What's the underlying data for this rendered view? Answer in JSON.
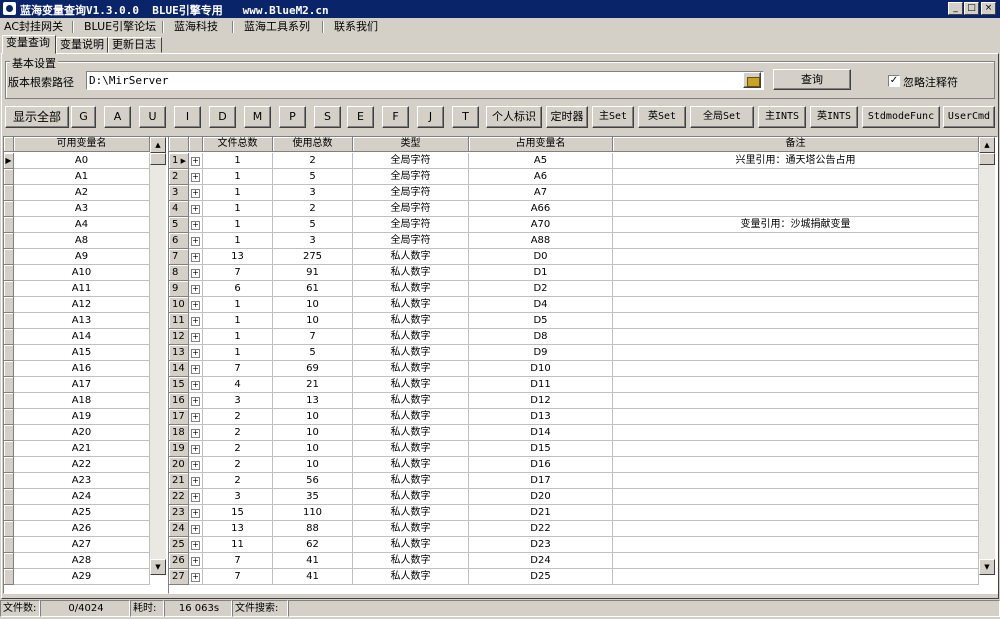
{
  "window": {
    "title": "蓝海变量查询V1.3.0.0  BLUE引擎专用   www.BlueM2.cn",
    "min_label": "_",
    "max_label": "□",
    "close_label": "×"
  },
  "menu": [
    "AC封挂网关",
    "BLUE引擎论坛",
    "蓝海科技",
    "蓝海工具系列",
    "联系我们"
  ],
  "tabs": [
    "变量查询",
    "变量说明",
    "更新日志"
  ],
  "settings": {
    "group_title": "基本设置",
    "path_label": "版本根索路径",
    "path_value": "D:\\MirServer",
    "query_button": "查询",
    "ignore_checked": true,
    "ignore_label": "忽略注释符"
  },
  "filter_buttons": [
    "显示全部",
    "G",
    "A",
    "U",
    "I",
    "D",
    "M",
    "P",
    "S",
    "E",
    "F",
    "J",
    "T",
    "个人标识",
    "定时器",
    "主Set",
    "英Set",
    "全局Set",
    "主INTS",
    "英INTS",
    "StdmodeFunc",
    "UserCmd"
  ],
  "left_grid": {
    "header": "可用变量名",
    "rows": [
      "A0",
      "A1",
      "A2",
      "A3",
      "A4",
      "A8",
      "A9",
      "A10",
      "A11",
      "A12",
      "A13",
      "A14",
      "A15",
      "A16",
      "A17",
      "A18",
      "A19",
      "A20",
      "A21",
      "A22",
      "A23",
      "A24",
      "A25",
      "A26",
      "A27",
      "A28",
      "A29"
    ]
  },
  "right_grid": {
    "headers": [
      "文件总数",
      "使用总数",
      "类型",
      "占用变量名",
      "备注"
    ],
    "rows": [
      {
        "n": "1",
        "files": "1",
        "uses": "2",
        "type": "全局字符",
        "var": "A5",
        "note": "兴里引用：通天塔公告占用"
      },
      {
        "n": "2",
        "files": "1",
        "uses": "5",
        "type": "全局字符",
        "var": "A6",
        "note": ""
      },
      {
        "n": "3",
        "files": "1",
        "uses": "3",
        "type": "全局字符",
        "var": "A7",
        "note": ""
      },
      {
        "n": "4",
        "files": "1",
        "uses": "2",
        "type": "全局字符",
        "var": "A66",
        "note": ""
      },
      {
        "n": "5",
        "files": "1",
        "uses": "5",
        "type": "全局字符",
        "var": "A70",
        "note": "变量引用：沙城捐献变量"
      },
      {
        "n": "6",
        "files": "1",
        "uses": "3",
        "type": "全局字符",
        "var": "A88",
        "note": ""
      },
      {
        "n": "7",
        "files": "13",
        "uses": "275",
        "type": "私人数字",
        "var": "D0",
        "note": ""
      },
      {
        "n": "8",
        "files": "7",
        "uses": "91",
        "type": "私人数字",
        "var": "D1",
        "note": ""
      },
      {
        "n": "9",
        "files": "6",
        "uses": "61",
        "type": "私人数字",
        "var": "D2",
        "note": ""
      },
      {
        "n": "10",
        "files": "1",
        "uses": "10",
        "type": "私人数字",
        "var": "D4",
        "note": ""
      },
      {
        "n": "11",
        "files": "1",
        "uses": "10",
        "type": "私人数字",
        "var": "D5",
        "note": ""
      },
      {
        "n": "12",
        "files": "1",
        "uses": "7",
        "type": "私人数字",
        "var": "D8",
        "note": ""
      },
      {
        "n": "13",
        "files": "1",
        "uses": "5",
        "type": "私人数字",
        "var": "D9",
        "note": ""
      },
      {
        "n": "14",
        "files": "7",
        "uses": "69",
        "type": "私人数字",
        "var": "D10",
        "note": ""
      },
      {
        "n": "15",
        "files": "4",
        "uses": "21",
        "type": "私人数字",
        "var": "D11",
        "note": ""
      },
      {
        "n": "16",
        "files": "3",
        "uses": "13",
        "type": "私人数字",
        "var": "D12",
        "note": ""
      },
      {
        "n": "17",
        "files": "2",
        "uses": "10",
        "type": "私人数字",
        "var": "D13",
        "note": ""
      },
      {
        "n": "18",
        "files": "2",
        "uses": "10",
        "type": "私人数字",
        "var": "D14",
        "note": ""
      },
      {
        "n": "19",
        "files": "2",
        "uses": "10",
        "type": "私人数字",
        "var": "D15",
        "note": ""
      },
      {
        "n": "20",
        "files": "2",
        "uses": "10",
        "type": "私人数字",
        "var": "D16",
        "note": ""
      },
      {
        "n": "21",
        "files": "2",
        "uses": "56",
        "type": "私人数字",
        "var": "D17",
        "note": ""
      },
      {
        "n": "22",
        "files": "3",
        "uses": "35",
        "type": "私人数字",
        "var": "D20",
        "note": ""
      },
      {
        "n": "23",
        "files": "15",
        "uses": "110",
        "type": "私人数字",
        "var": "D21",
        "note": ""
      },
      {
        "n": "24",
        "files": "13",
        "uses": "88",
        "type": "私人数字",
        "var": "D22",
        "note": ""
      },
      {
        "n": "25",
        "files": "11",
        "uses": "62",
        "type": "私人数字",
        "var": "D23",
        "note": ""
      },
      {
        "n": "26",
        "files": "7",
        "uses": "41",
        "type": "私人数字",
        "var": "D24",
        "note": ""
      },
      {
        "n": "27",
        "files": "7",
        "uses": "41",
        "type": "私人数字",
        "var": "D25",
        "note": ""
      }
    ]
  },
  "status": {
    "files_label": "文件数:",
    "files_value": "0/4024",
    "time_label": "耗时:",
    "time_value": "16 063s",
    "search_label": "文件搜索:"
  }
}
